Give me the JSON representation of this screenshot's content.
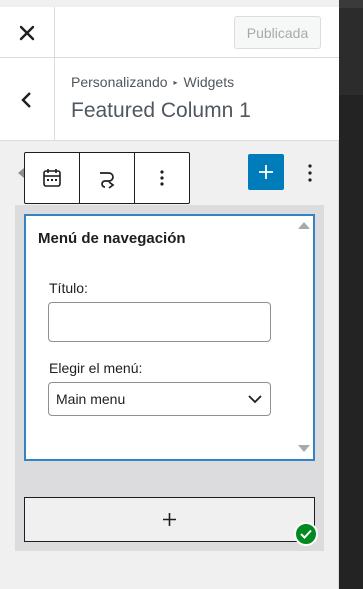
{
  "header": {
    "close_label": "×",
    "publish_label": "Publicada"
  },
  "titlebar": {
    "breadcrumb_root": "Personalizando",
    "breadcrumb_separator": "▸",
    "breadcrumb_current": "Widgets",
    "title": "Featured Column 1"
  },
  "toolbar": {
    "buttons": [
      {
        "icon": "calendar-icon"
      },
      {
        "icon": "transform-icon"
      },
      {
        "icon": "more-options-icon"
      }
    ],
    "add_icon": "plus-icon",
    "more_icon": "vertical-ellipsis-icon",
    "accent": "#007cba"
  },
  "widget": {
    "title": "Menú de navegación",
    "title_field_label": "Título:",
    "title_field_value": "",
    "menu_field_label": "Elegir el menú:",
    "menu_selected": "Main menu",
    "border_color": "#3582c4"
  },
  "append": {
    "icon": "plus-icon"
  },
  "status": {
    "saved_icon": "check-icon",
    "saved_color": "#008a20"
  }
}
